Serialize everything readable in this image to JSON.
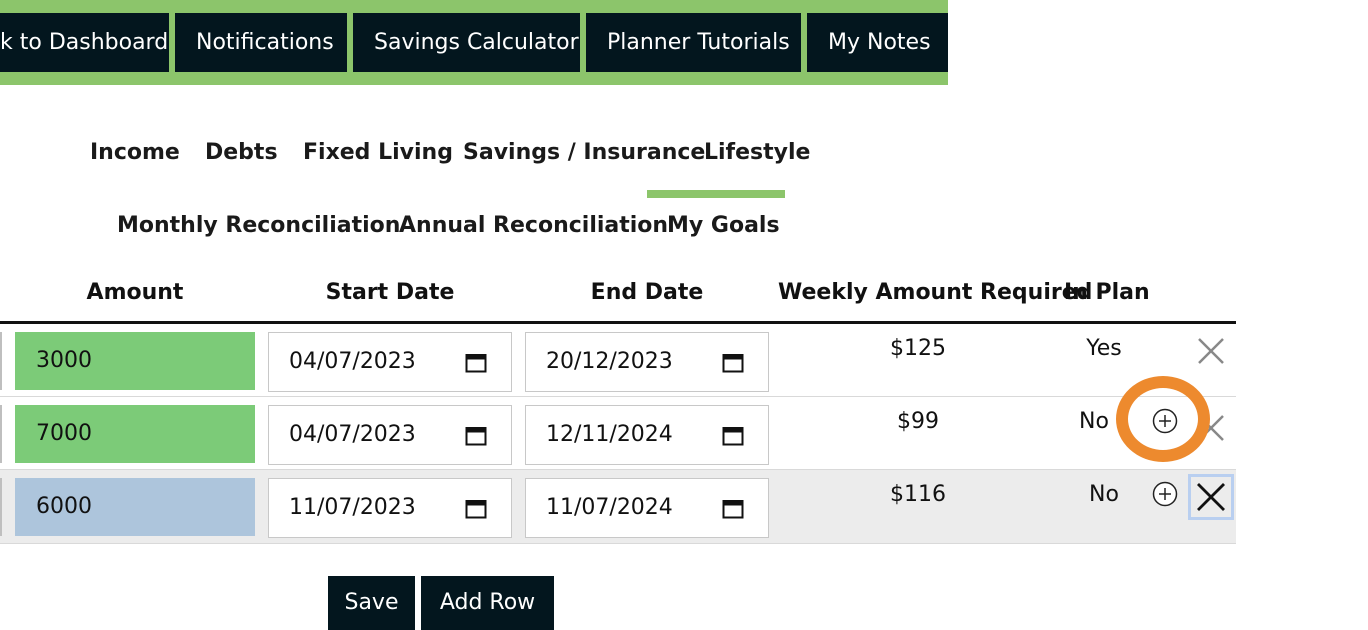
{
  "nav": {
    "buttons": [
      "k to Dashboard",
      "Notifications",
      "Savings Calculator",
      "Planner Tutorials",
      "My Notes"
    ]
  },
  "tabs": {
    "row1": [
      "Income",
      "Debts",
      "Fixed Living",
      "Savings / Insurance",
      "Lifestyle"
    ],
    "row2": [
      "Monthly Reconciliation",
      "Annual Reconciliation",
      "My Goals"
    ],
    "active": "Lifestyle"
  },
  "table": {
    "headers": [
      "Amount",
      "Start Date",
      "End Date",
      "Weekly Amount Required",
      "In Plan"
    ],
    "rows": [
      {
        "amount": "3000",
        "start_date": "04/07/2023",
        "end_date": "20/12/2023",
        "weekly": "$125",
        "in_plan": "Yes"
      },
      {
        "amount": "7000",
        "start_date": "04/07/2023",
        "end_date": "12/11/2024",
        "weekly": "$99",
        "in_plan": "No"
      },
      {
        "amount": "6000",
        "start_date": "11/07/2023",
        "end_date": "11/07/2024",
        "weekly": "$116",
        "in_plan": "No"
      }
    ]
  },
  "actions": {
    "save": "Save",
    "add_row": "Add Row"
  },
  "colors": {
    "brand_green": "#8cc56b",
    "dark": "#03161e",
    "amount_green": "#7ccb78",
    "amount_blue": "#adc5dc",
    "highlight_orange": "#ed8a2e"
  }
}
